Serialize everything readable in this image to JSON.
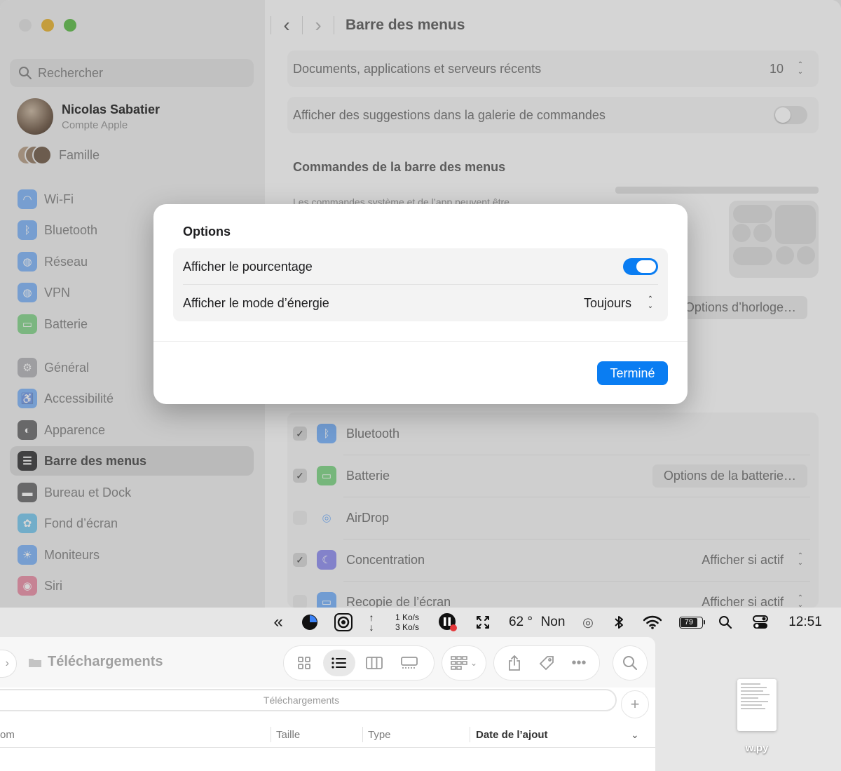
{
  "settings": {
    "search_placeholder": "Rechercher",
    "user": {
      "name": "Nicolas Sabatier",
      "subtitle": "Compte Apple"
    },
    "family_label": "Famille",
    "sidebar": [
      {
        "label": "Wi-Fi",
        "icon": "wifi-icon",
        "color": "#3b8ef5"
      },
      {
        "label": "Bluetooth",
        "icon": "bluetooth-icon",
        "color": "#3b8ef5"
      },
      {
        "label": "Réseau",
        "icon": "globe-icon",
        "color": "#3b8ef5"
      },
      {
        "label": "VPN",
        "icon": "vpn-globe-icon",
        "color": "#3b8ef5"
      },
      {
        "label": "Batterie",
        "icon": "battery-icon",
        "color": "#45c04f"
      },
      {
        "label": "Général",
        "icon": "gear-icon",
        "color": "#8e8e93"
      },
      {
        "label": "Accessibilité",
        "icon": "accessibility-icon",
        "color": "#3b8ef5"
      },
      {
        "label": "Apparence",
        "icon": "appearance-icon",
        "color": "#1d1d1f"
      },
      {
        "label": "Barre des menus",
        "icon": "menubar-icon",
        "color": "#1d1d1f",
        "active": true
      },
      {
        "label": "Bureau et Dock",
        "icon": "dock-icon",
        "color": "#1d1d1f"
      },
      {
        "label": "Fond d’écran",
        "icon": "wallpaper-icon",
        "color": "#32ade6"
      },
      {
        "label": "Moniteurs",
        "icon": "display-icon",
        "color": "#3b8ef5"
      },
      {
        "label": "Siri",
        "icon": "siri-icon",
        "color": "#e0557a"
      }
    ],
    "page_title": "Barre des menus",
    "recent_docs": {
      "label": "Documents, applications et serveurs récents",
      "value": "10"
    },
    "suggestions_label": "Afficher des suggestions dans la galerie de commandes",
    "section_header": "Commandes de la barre des menus",
    "section_sub": "Les commandes système et de l’app peuvent être",
    "clock_options": "Options d’horloge…",
    "controls": [
      {
        "label": "Bluetooth",
        "checked": true,
        "icon": "bluetooth-icon",
        "color": "#3b8ef5"
      },
      {
        "label": "Batterie",
        "checked": true,
        "icon": "battery-icon",
        "color": "#45c04f",
        "action": "Options de la batterie…"
      },
      {
        "label": "AirDrop",
        "checked": false,
        "icon": "airdrop-icon",
        "color": "#3b8ef5"
      },
      {
        "label": "Concentration",
        "checked": true,
        "icon": "moon-icon",
        "color": "#5e5ce6",
        "value": "Afficher si actif"
      },
      {
        "label": "Recopie de l’écran",
        "checked": false,
        "icon": "screen-mirror-icon",
        "color": "#3b8ef5",
        "value": "Afficher si actif"
      }
    ]
  },
  "modal": {
    "title": "Options",
    "show_percentage_label": "Afficher le pourcentage",
    "show_percentage_on": true,
    "energy_mode_label": "Afficher le mode d’énergie",
    "energy_mode_value": "Toujours",
    "done_label": "Terminé",
    "accent": "#0a7df2"
  },
  "menubar": {
    "net_up": "1 Ko/s",
    "net_down": "3 Ko/s",
    "weather": "62 °",
    "non_label": "Non",
    "battery_percent": "79",
    "time": "12:51"
  },
  "finder": {
    "title": "Téléchargements",
    "path_label": "Téléchargements",
    "columns": {
      "name": "om",
      "size": "Taille",
      "type": "Type",
      "date": "Date de l’ajout"
    }
  },
  "desktop": {
    "file_label": "w.py"
  }
}
